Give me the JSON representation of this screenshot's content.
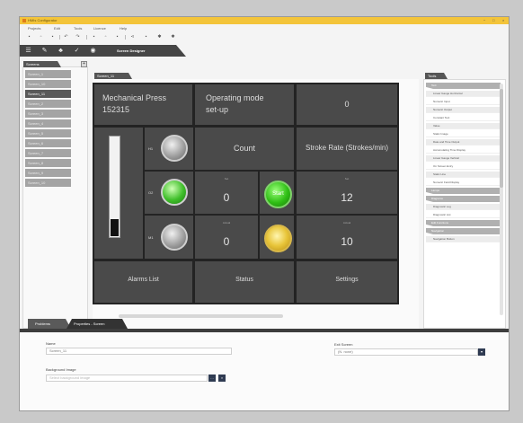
{
  "window": {
    "title": "HMIs Configurator",
    "controls": [
      "−",
      "□",
      "×"
    ]
  },
  "menu": [
    "Projects",
    "Edit",
    "Tools",
    "Licence",
    "Help"
  ],
  "toolbar_icons": [
    "new-file-icon",
    "open-icon",
    "save-icon",
    "undo-icon",
    "redo-icon",
    "print-icon",
    "monitor-icon",
    "settings-icon",
    "share-icon",
    "download-icon",
    "gear-icon",
    "config-icon"
  ],
  "ribbon": {
    "label": "Screen Designer",
    "icons": [
      "list-icon",
      "edit-icon",
      "sitemap-icon",
      "tools-icon",
      "help-icon"
    ]
  },
  "screens_panel": {
    "tab": "Screens",
    "add_glyph": "+",
    "items": [
      "Screen_1",
      "Screen_10",
      "Screen_11",
      "Screen_2",
      "Screen_3",
      "Screen_4",
      "Screen_5",
      "Screen_6",
      "Screen_7",
      "Screen_8",
      "Screen_9",
      "Screen_10"
    ],
    "active_index": 2
  },
  "editor": {
    "tab": "Screen_11"
  },
  "hmi": {
    "title_line1": "Mechanical Press",
    "title_line2": "152315",
    "mode_line1": "Operating mode",
    "mode_line2": "set-up",
    "top_value": "0",
    "gauge_fraction": 0.17,
    "lamps": [
      {
        "label": "H1",
        "color": "grey"
      },
      {
        "label": "O2",
        "color": "green"
      },
      {
        "label": "M1",
        "color": "grey"
      }
    ],
    "count": {
      "header": "Count",
      "set_label": "Set",
      "set_value": "0",
      "actual_label": "Actual",
      "actual_value": "0"
    },
    "stroke": {
      "header": "Stroke Rate (Strokes/min)",
      "set_label": "Set",
      "set_value": "12",
      "actual_label": "Actual",
      "actual_value": "10"
    },
    "start_label": "Start",
    "bottom_buttons": [
      "Alarms List",
      "Status",
      "Settings"
    ]
  },
  "tools_panel": {
    "tab": "Tools",
    "sections": [
      {
        "title": "Text",
        "items": [
          "Linear Gauge Horizontal",
          "Numeric Input",
          "Numeric Output",
          "Constant Text",
          "Value",
          "Static Image",
          "Date and Time Output",
          "Accumulating Time Display",
          "Linear Gauge Vertical",
          "On Screen Entry",
          "Static Line",
          "Numeric Field Display"
        ]
      },
      {
        "title": "Lamps",
        "items": []
      },
      {
        "title": "Diagrams",
        "items": [
          "Diagnostic Log",
          "Diagnostic List"
        ]
      },
      {
        "title": "Edit Functions",
        "items": []
      },
      {
        "title": "Navigation",
        "items": [
          "Navigation Button"
        ]
      }
    ]
  },
  "bottom_tabs": [
    "Problems",
    "Properties - Screen"
  ],
  "properties": {
    "name_label": "Name",
    "name_value": "Screen_11",
    "bg_label": "Background Image",
    "bg_placeholder": "Select background image",
    "exit_label": "Exit Screen",
    "exit_value": "(N. none)",
    "browse_glyph": "…",
    "clear_glyph": "×",
    "dropdown_glyph": "▾"
  }
}
